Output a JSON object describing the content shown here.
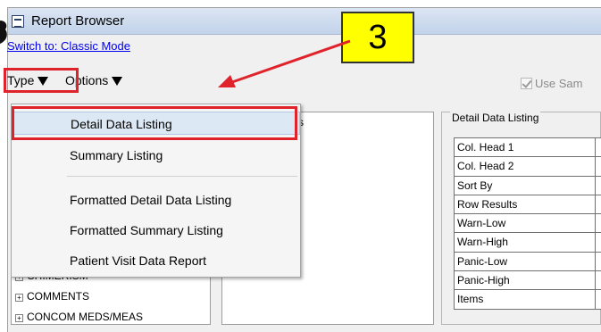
{
  "window": {
    "title": "Report Browser"
  },
  "switch_link": "Switch to: Classic Mode",
  "menu": {
    "type": "Type",
    "options": "Options"
  },
  "use_same_label": "Use Sam",
  "left_tree": {
    "items": [
      {
        "label": "CHIMERISM",
        "icon": "plus-box-icon"
      },
      {
        "label": "COMMENTS",
        "icon": "plus-box-icon"
      },
      {
        "label": "CONCOM MEDS/MEAS",
        "icon": "plus-box-icon"
      }
    ]
  },
  "middle_panel": {
    "label_fragment": "s"
  },
  "right_panel": {
    "group_label": "Detail Data Listing",
    "rows": [
      "Col. Head 1",
      "Col. Head 2",
      "Sort By",
      "Row Results",
      "Warn-Low",
      "Warn-High",
      "Panic-Low",
      "Panic-High",
      "Items"
    ]
  },
  "type_dropdown": {
    "items": [
      "Detail Data Listing",
      "Summary Listing",
      "Formatted Detail Data Listing",
      "Formatted Summary Listing",
      "Patient Visit Data Report"
    ],
    "selected": "Detail Data Listing"
  },
  "callout": {
    "number": "3"
  },
  "colors": {
    "highlight_red": "#e0232b",
    "callout_yellow": "#ffff00",
    "link_blue": "#0000ee"
  }
}
